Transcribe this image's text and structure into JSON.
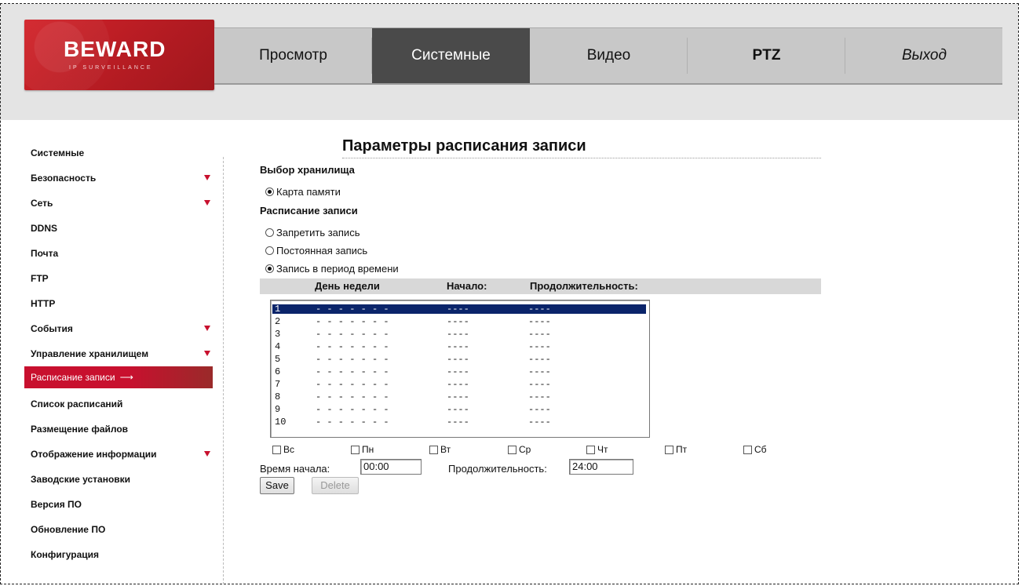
{
  "logo": {
    "text": "BEWARD",
    "sub": "IP SURVEILLANCE"
  },
  "nav": [
    {
      "label": "Просмотр"
    },
    {
      "label": "Системные"
    },
    {
      "label": "Видео"
    },
    {
      "label": "PTZ"
    },
    {
      "label": "Выход"
    }
  ],
  "sidebar": {
    "items": [
      {
        "label": "Системные"
      },
      {
        "label": "Безопасность"
      },
      {
        "label": "Сеть"
      },
      {
        "label": "DDNS"
      },
      {
        "label": "Почта"
      },
      {
        "label": "FTP"
      },
      {
        "label": "HTTP"
      },
      {
        "label": "События"
      },
      {
        "label": "Управление хранилищем"
      },
      {
        "label": "Расписание записи"
      },
      {
        "label": "Список расписаний"
      },
      {
        "label": "Размещение файлов"
      },
      {
        "label": "Отображение информации"
      },
      {
        "label": "Заводские установки"
      },
      {
        "label": "Версия ПО"
      },
      {
        "label": "Обновление ПО"
      },
      {
        "label": "Конфигурация"
      }
    ],
    "active_arrow": "⟶"
  },
  "page": {
    "title": "Параметры расписания записи",
    "storage_heading": "Выбор хранилища",
    "storage_option": "Карта памяти",
    "schedule_heading": "Расписание записи",
    "mode_options": [
      "Запретить запись",
      "Постоянная запись",
      "Запись в период времени"
    ]
  },
  "table": {
    "headers": {
      "day": "День недели",
      "start": "Начало:",
      "duration": "Продолжительность:"
    },
    "rows": [
      {
        "num": "1",
        "days": "- - - - - - -",
        "start": "----",
        "duration": "----"
      },
      {
        "num": "2",
        "days": "- - - - - - -",
        "start": "----",
        "duration": "----"
      },
      {
        "num": "3",
        "days": "- - - - - - -",
        "start": "----",
        "duration": "----"
      },
      {
        "num": "4",
        "days": "- - - - - - -",
        "start": "----",
        "duration": "----"
      },
      {
        "num": "5",
        "days": "- - - - - - -",
        "start": "----",
        "duration": "----"
      },
      {
        "num": "6",
        "days": "- - - - - - -",
        "start": "----",
        "duration": "----"
      },
      {
        "num": "7",
        "days": "- - - - - - -",
        "start": "----",
        "duration": "----"
      },
      {
        "num": "8",
        "days": "- - - - - - -",
        "start": "----",
        "duration": "----"
      },
      {
        "num": "9",
        "days": "- - - - - - -",
        "start": "----",
        "duration": "----"
      },
      {
        "num": "10",
        "days": "- - - - - - -",
        "start": "----",
        "duration": "----"
      }
    ]
  },
  "days": [
    "Вс",
    "Пн",
    "Вт",
    "Ср",
    "Чт",
    "Пт",
    "Сб"
  ],
  "form": {
    "start_label": "Время начала:",
    "start_value": "00:00",
    "duration_label": "Продолжительность:",
    "duration_value": "24:00",
    "save_label": "Save",
    "delete_label": "Delete"
  },
  "colors": {
    "brand_red": "#c8102e",
    "nav_active": "#4a4a4a",
    "selection": "#0a246a"
  }
}
